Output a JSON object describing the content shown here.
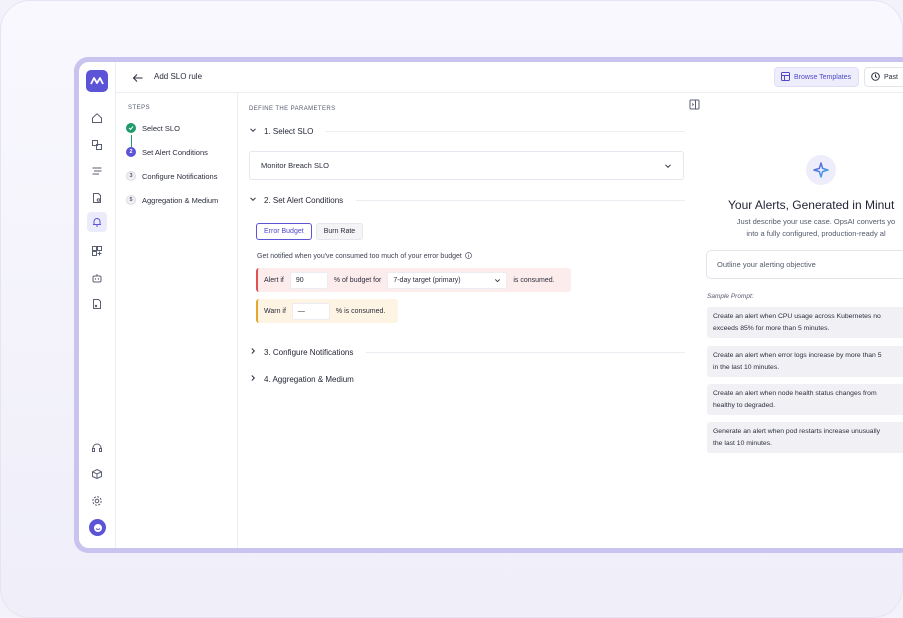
{
  "header": {
    "title": "Add SLO rule",
    "browse_label": "Browse Templates",
    "past_label": "Past"
  },
  "steps": {
    "heading": "STEPS",
    "items": [
      {
        "num": "",
        "label": "Select SLO",
        "state": "done"
      },
      {
        "num": "2",
        "label": "Set Alert Conditions",
        "state": "active"
      },
      {
        "num": "3",
        "label": "Configure Notifications",
        "state": "todo"
      },
      {
        "num": "5",
        "label": "Aggregation & Medium",
        "state": "todo"
      }
    ]
  },
  "form": {
    "heading": "DEFINE THE PARAMETERS",
    "section1": "1. Select SLO",
    "slo_value": "Monitor Breach SLO",
    "section2": "2. Set Alert Conditions",
    "tab_error_budget": "Error Budget",
    "tab_burn_rate": "Burn Rate",
    "notify_text": "Get notified when you've consumed too much of your error budget",
    "alert_if": "Alert if",
    "alert_value": "90",
    "budget_for": "% of budget for",
    "target_value": "7-day target (primary)",
    "consumed": "is consumed.",
    "warn_if": "Warn if",
    "warn_value": "—",
    "warn_consumed": "% is consumed.",
    "section3": "3. Configure Notifications",
    "section4": "4. Aggregation & Medium"
  },
  "ai": {
    "title": "Your Alerts, Generated in Minut",
    "desc_line1": "Just describe your use case. OpsAI converts yo",
    "desc_line2": "into a fully configured, production-ready al",
    "input_placeholder": "Outline your alerting objective",
    "sample_label": "Sample Prompt:",
    "prompts": [
      {
        "line1": "Create an alert when CPU usage across Kubernetes no",
        "line2": "exceeds 85% for more than 5 minutes."
      },
      {
        "line1": "Create an alert when error logs increase by more than 5",
        "line2": "in the last 10 minutes."
      },
      {
        "line1": "Create an alert when node health status changes from",
        "line2": "healthy to degraded."
      },
      {
        "line1": "Generate an alert when pod restarts increase unusually",
        "line2": "the last 10 minutes."
      }
    ]
  },
  "colors": {
    "accent": "#5b54d6",
    "success": "#1f9a6a",
    "alert_bg": "#fdecec",
    "warn_bg": "#fdf4e3"
  }
}
